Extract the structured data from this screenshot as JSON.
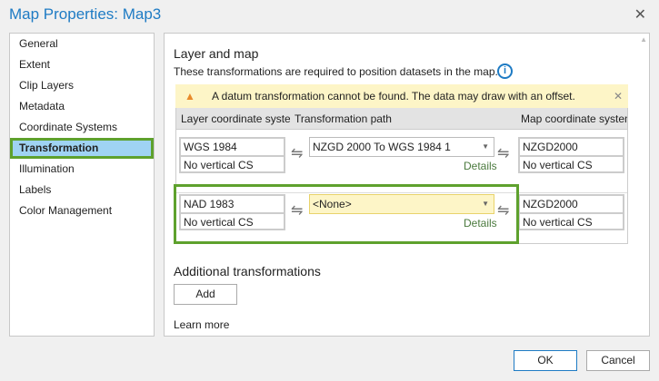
{
  "title": "Map Properties: Map3",
  "nav": [
    "General",
    "Extent",
    "Clip Layers",
    "Metadata",
    "Coordinate Systems",
    "Transformation",
    "Illumination",
    "Labels",
    "Color Management"
  ],
  "main": {
    "heading": "Layer and map",
    "description": "These transformations are required to position datasets in the map.",
    "warning": "A datum transformation cannot be found. The data may draw with an offset.",
    "columns": [
      "Layer coordinate system",
      "Transformation path",
      "Map coordinate system"
    ],
    "rows": [
      {
        "layer": "WGS 1984",
        "layer_v": "No vertical CS",
        "path": "NZGD 2000 To WGS 1984 1",
        "details": "Details",
        "map": "NZGD2000",
        "map_v": "No vertical CS"
      },
      {
        "layer": "NAD 1983",
        "layer_v": "No vertical CS",
        "path": "<None>",
        "details": "Details",
        "map": "NZGD2000",
        "map_v": "No vertical CS"
      }
    ],
    "additional": "Additional transformations",
    "add": "Add",
    "learn_more": "Learn more"
  },
  "footer": {
    "ok": "OK",
    "cancel": "Cancel"
  }
}
